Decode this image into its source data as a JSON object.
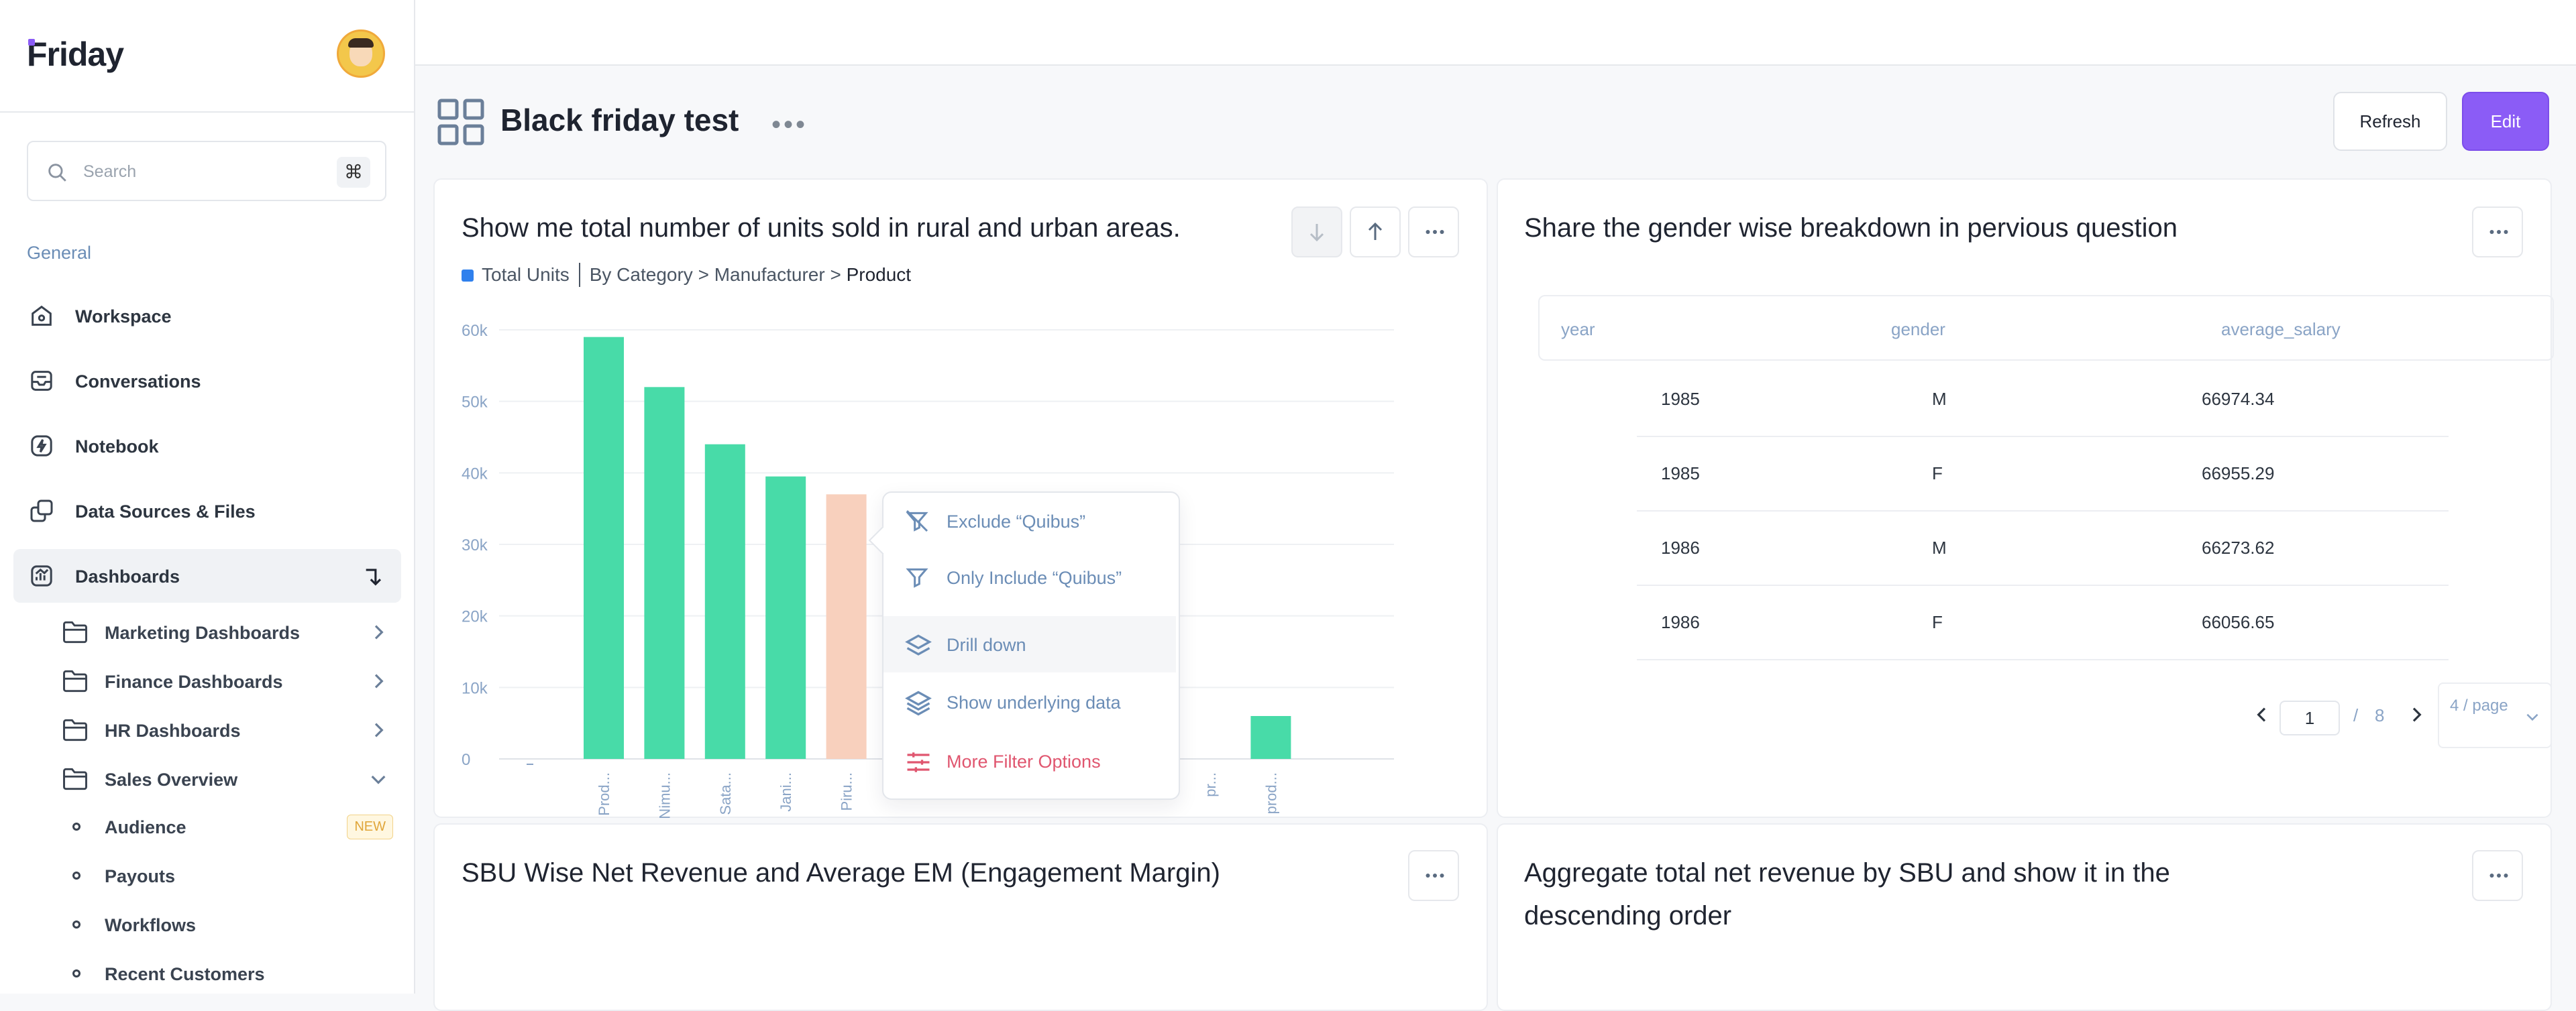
{
  "app": {
    "name": "Friday"
  },
  "search": {
    "placeholder": "Search",
    "shortcut": "⌘"
  },
  "sidebar": {
    "section": "General",
    "items": [
      {
        "label": "Workspace"
      },
      {
        "label": "Conversations"
      },
      {
        "label": "Notebook"
      },
      {
        "label": "Data Sources & Files"
      },
      {
        "label": "Dashboards"
      }
    ],
    "folders": [
      {
        "label": "Marketing Dashboards"
      },
      {
        "label": "Finance Dashboards"
      },
      {
        "label": "HR Dashboards"
      },
      {
        "label": "Sales Overview"
      }
    ],
    "sales_children": [
      {
        "label": "Audience",
        "badge": "NEW"
      },
      {
        "label": "Payouts"
      },
      {
        "label": "Workflows"
      },
      {
        "label": "Recent Customers"
      }
    ]
  },
  "header": {
    "title": "Black friday test",
    "refresh_label": "Refresh",
    "edit_label": "Edit"
  },
  "cards": {
    "units": {
      "title": "Show me total number of units sold in rural and urban areas.",
      "legend_series": "Total Units",
      "breadcrumb_path": "By Category > Manufacturer > ",
      "breadcrumb_current": "Product"
    },
    "gender": {
      "title": "Share the gender wise breakdown in pervious question",
      "columns": [
        "year",
        "gender",
        "average_salary"
      ],
      "rows": [
        [
          "1985",
          "M",
          "66974.34"
        ],
        [
          "1985",
          "F",
          "66955.29"
        ],
        [
          "1986",
          "M",
          "66273.62"
        ],
        [
          "1986",
          "F",
          "66056.65"
        ]
      ],
      "page": "1",
      "page_sep": "/",
      "page_total": "8",
      "page_size": "4 / page"
    },
    "sbu": {
      "title": "SBU Wise Net Revenue and Average EM (Engagement Margin)"
    },
    "aggregate": {
      "title": "Aggregate total net revenue by SBU and show it in the descending order"
    }
  },
  "context_menu": {
    "items": [
      {
        "label": "Exclude “Quibus”",
        "icon": "filter-off-icon"
      },
      {
        "label": "Only Include “Quibus”",
        "icon": "filter-icon"
      },
      {
        "label": "Drill down",
        "icon": "layers-icon"
      },
      {
        "label": "Show underlying data",
        "icon": "stack-icon"
      },
      {
        "label": "More Filter Options",
        "icon": "sliders-icon"
      }
    ]
  },
  "colors": {
    "accent": "#8b5cf6",
    "bar": "#48dba8",
    "bar_selected": "#f8d0bd",
    "legend": "#2f80ed",
    "danger": "#e0566f"
  },
  "chart_data": {
    "type": "bar",
    "series": [
      {
        "name": "Total Units",
        "values": [
          59000,
          52000,
          44000,
          39500,
          37000,
          0,
          0,
          0,
          0,
          0,
          0,
          6000
        ]
      }
    ],
    "categories": [
      "Prod...",
      "Nimu...",
      "Sata...",
      "Jani...",
      "Piru...",
      "pr...",
      "pr...",
      "pr...",
      "pr...",
      "pr...",
      "pr...",
      "prod..."
    ],
    "y_ticks": [
      "0",
      "10k",
      "20k",
      "30k",
      "40k",
      "50k",
      "60k"
    ],
    "ylim": [
      0,
      60000
    ],
    "selected_index": 4,
    "grid": true
  }
}
